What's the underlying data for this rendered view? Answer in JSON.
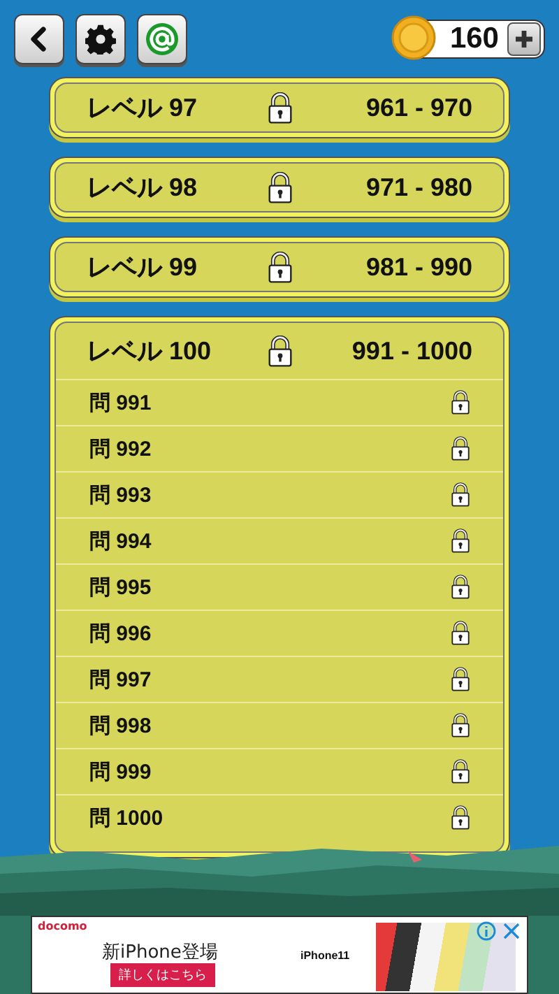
{
  "toolbar": {
    "buttons": [
      {
        "kind": "back"
      },
      {
        "kind": "settings"
      },
      {
        "kind": "mail"
      }
    ]
  },
  "coins": {
    "count": "160"
  },
  "levels": [
    {
      "label": "レベル 97",
      "range": "961 - 970",
      "locked": true,
      "expanded": false
    },
    {
      "label": "レベル 98",
      "range": "971 - 980",
      "locked": true,
      "expanded": false
    },
    {
      "label": "レベル 99",
      "range": "981 - 990",
      "locked": true,
      "expanded": false
    },
    {
      "label": "レベル 100",
      "range": "991 - 1000",
      "locked": true,
      "expanded": true,
      "questions": [
        {
          "label": "問 991",
          "locked": true
        },
        {
          "label": "問 992",
          "locked": true
        },
        {
          "label": "問 993",
          "locked": true
        },
        {
          "label": "問 994",
          "locked": true
        },
        {
          "label": "問 995",
          "locked": true
        },
        {
          "label": "問 996",
          "locked": true
        },
        {
          "label": "問 997",
          "locked": true
        },
        {
          "label": "問 998",
          "locked": true
        },
        {
          "label": "問 999",
          "locked": true
        },
        {
          "label": "問 1000",
          "locked": true
        }
      ]
    }
  ],
  "ad": {
    "brand": "docomo",
    "headline": "新iPhone登場",
    "button": "詳しくはこちら",
    "product": "iPhone11"
  }
}
